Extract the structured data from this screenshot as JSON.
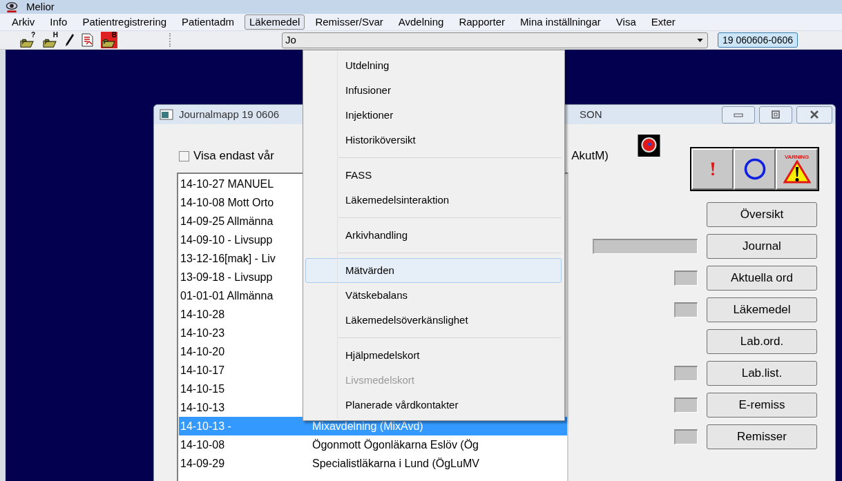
{
  "app": {
    "title": "Melior"
  },
  "menu_bar": [
    {
      "label": "Arkiv",
      "selected": false
    },
    {
      "label": "Info",
      "selected": false
    },
    {
      "label": "Patientregistrering",
      "selected": false
    },
    {
      "label": "Patientadm",
      "selected": false
    },
    {
      "label": "Läkemedel",
      "selected": true
    },
    {
      "label": "Remisser/Svar",
      "selected": false
    },
    {
      "label": "Avdelning",
      "selected": false
    },
    {
      "label": "Rapporter",
      "selected": false
    },
    {
      "label": "Mina inställningar",
      "selected": false
    },
    {
      "label": "Visa",
      "selected": false
    },
    {
      "label": "Exter",
      "selected": false
    }
  ],
  "toolbar": {
    "buttons": [
      {
        "kind": "folder",
        "badge": "?"
      },
      {
        "kind": "folder",
        "badge": "H"
      },
      {
        "kind": "pen"
      },
      {
        "kind": "document"
      },
      {
        "kind": "folder-red",
        "badge": "B"
      }
    ],
    "combo": {
      "value": "Jo"
    },
    "patient_id": "19 060606-0606"
  },
  "dropdown_menu": {
    "groups": [
      {
        "items": [
          {
            "label": "Utdelning",
            "selected": false,
            "disabled": false
          },
          {
            "label": "Infusioner",
            "selected": false,
            "disabled": false
          },
          {
            "label": "Injektioner",
            "selected": false,
            "disabled": false
          },
          {
            "label": "Historiköversikt",
            "selected": false,
            "disabled": false
          }
        ]
      },
      {
        "items": [
          {
            "label": "FASS",
            "selected": false,
            "disabled": false
          },
          {
            "label": "Läkemedelsinteraktion",
            "selected": false,
            "disabled": false
          }
        ]
      },
      {
        "items": [
          {
            "label": "Arkivhandling",
            "selected": false,
            "disabled": false
          }
        ]
      },
      {
        "items": [
          {
            "label": "Mätvärden",
            "selected": true,
            "disabled": false
          },
          {
            "label": "Vätskebalans",
            "selected": false,
            "disabled": false
          },
          {
            "label": "Läkemedelsöverkänslighet",
            "selected": false,
            "disabled": false
          }
        ]
      },
      {
        "items": [
          {
            "label": "Hjälpmedelskort",
            "selected": false,
            "disabled": false
          },
          {
            "label": "Livsmedelskort",
            "selected": false,
            "disabled": true
          },
          {
            "label": "Planerade vårdkontakter",
            "selected": false,
            "disabled": false
          }
        ]
      }
    ]
  },
  "journal_window": {
    "title_parts": [
      "Journalmapp 19 0606",
      "SON"
    ],
    "filter": {
      "label": "Visa endast vår",
      "label_tail": "AkutM)",
      "checked": false
    },
    "visits": [
      {
        "col1": "14-10-27 MANUEL",
        "selected": false
      },
      {
        "col1": "14-10-08 Mott Orto",
        "selected": false
      },
      {
        "col1": "14-09-25 Allmänna",
        "selected": false
      },
      {
        "col1": "14-09-10 - Livsupp",
        "selected": false
      },
      {
        "col1": "13-12-16[mak] - Liv",
        "selected": false
      },
      {
        "col1": "13-09-18 - Livsupp",
        "selected": false
      },
      {
        "col1": "01-01-01 Allmänna",
        "selected": false
      },
      {
        "col1": "14-10-28",
        "selected": false
      },
      {
        "col1": "14-10-23",
        "selected": false
      },
      {
        "col1": "14-10-20",
        "selected": false
      },
      {
        "col1": "14-10-17",
        "selected": false
      },
      {
        "col1": "14-10-15",
        "selected": false
      },
      {
        "col1": "14-10-13",
        "selected": false
      },
      {
        "col1": "14-10-13 -",
        "col2": "Mixavdelning (MixAvd)",
        "selected": true
      },
      {
        "col1": "14-10-08",
        "col2": "Ögonmott Ögonläkarna Eslöv (Ög",
        "selected": false
      },
      {
        "col1": "14-09-29",
        "col2": "Specialistläkarna i Lund (ÖgLuMV",
        "selected": false
      }
    ],
    "alert_buttons": [
      {
        "kind": "exclamation"
      },
      {
        "kind": "circle"
      },
      {
        "kind": "warning",
        "label": "VARNING"
      }
    ],
    "actions": [
      {
        "label": "Översikt",
        "kind": "plain"
      },
      {
        "label": "Journal",
        "kind": "wide"
      },
      {
        "label": "Aktuella ord",
        "kind": "small"
      },
      {
        "label": "Läkemedel",
        "kind": "small"
      },
      {
        "label": "Lab.ord.",
        "kind": "plain"
      },
      {
        "label": "Lab.list.",
        "kind": "small"
      },
      {
        "label": "E-remiss",
        "kind": "small"
      },
      {
        "label": "Remisser",
        "kind": "small"
      }
    ]
  }
}
